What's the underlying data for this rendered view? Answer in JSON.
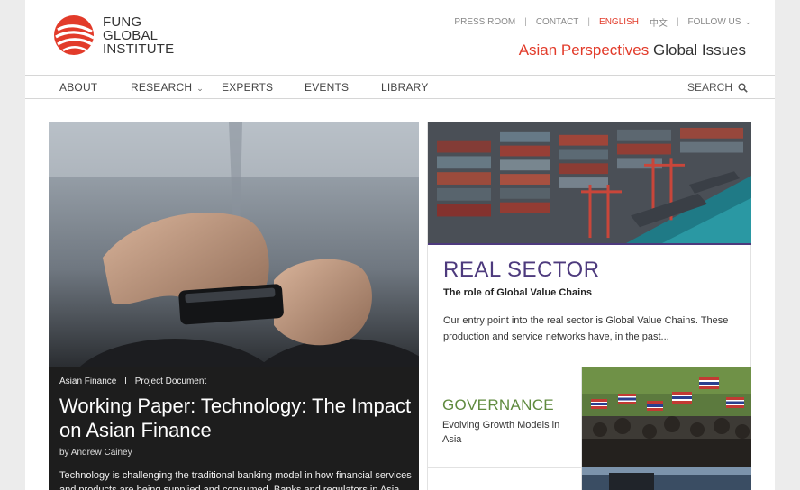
{
  "brand": {
    "line1": "FUNG",
    "line2": "GLOBAL",
    "line3": "INSTITUTE",
    "accent_color": "#e23b2a"
  },
  "utility_nav": {
    "press_room": "PRESS ROOM",
    "contact": "CONTACT",
    "english": "ENGLISH",
    "chinese": "中文",
    "follow_us": "FOLLOW US"
  },
  "tagline": {
    "accent": "Asian Perspectives",
    "main": "Global Issues"
  },
  "main_nav": {
    "about": "ABOUT",
    "research": "RESEARCH",
    "experts": "EXPERTS",
    "events": "EVENTS",
    "library": "LIBRARY",
    "search": "SEARCH"
  },
  "hero": {
    "category": "Asian Finance",
    "meta_separator": "I",
    "doc_type": "Project Document",
    "title": "Working Paper: Technology: The Impact on Asian Finance",
    "author": "by Andrew Cainey",
    "excerpt": "Technology is challenging the traditional banking model in how financial services and products are being supplied and consumed. Banks and regulators in Asia"
  },
  "feature": {
    "title": "REAL SECTOR",
    "subtitle": "The role of Global Value Chains",
    "body": "Our entry point into the real sector is Global Value Chains. These production and service networks have, in the past...",
    "title_color": "#4d3a7d"
  },
  "governance": {
    "title": "GOVERNANCE",
    "subtitle": "Evolving Growth Models in Asia",
    "title_color": "#5f8a3e"
  }
}
